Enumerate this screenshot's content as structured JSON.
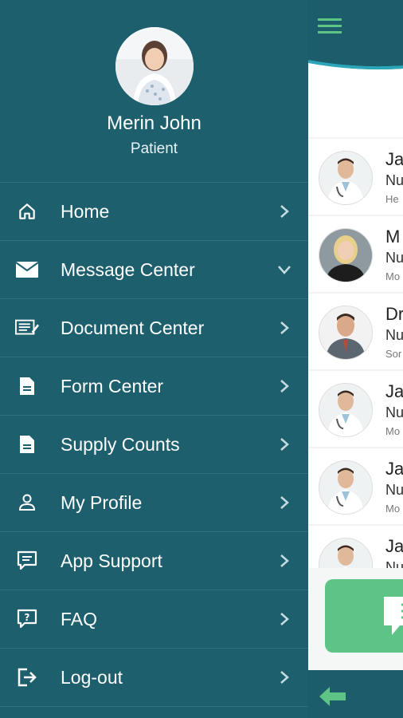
{
  "profile": {
    "name": "Merin John",
    "role": "Patient"
  },
  "menu": [
    {
      "label": "Home",
      "icon": "home-icon",
      "chevron": "right"
    },
    {
      "label": "Message Center",
      "icon": "envelope-icon",
      "chevron": "down"
    },
    {
      "label": "Document Center",
      "icon": "document-edit-icon",
      "chevron": "right"
    },
    {
      "label": "Form Center",
      "icon": "file-icon",
      "chevron": "right"
    },
    {
      "label": "Supply Counts",
      "icon": "file-icon",
      "chevron": "right"
    },
    {
      "label": "My Profile",
      "icon": "person-icon",
      "chevron": "right"
    },
    {
      "label": "App Support",
      "icon": "chat-icon",
      "chevron": "right"
    },
    {
      "label": "FAQ",
      "icon": "help-icon",
      "chevron": "right"
    },
    {
      "label": "Log-out",
      "icon": "logout-icon",
      "chevron": "right"
    }
  ],
  "contacts": [
    {
      "name": "Ja",
      "title": "Nu",
      "sub": "He",
      "avatar": "doctor"
    },
    {
      "name": "M",
      "title": "Nu",
      "sub": "Mo",
      "avatar": "woman"
    },
    {
      "name": "Dr",
      "title": "Nu",
      "sub": "Sor",
      "avatar": "man"
    },
    {
      "name": "Ja",
      "title": "Nu",
      "sub": "Mo",
      "avatar": "doctor"
    },
    {
      "name": "Ja",
      "title": "Nu",
      "sub": "Mo",
      "avatar": "doctor"
    },
    {
      "name": "Ja",
      "title": "Nu",
      "sub": "",
      "avatar": "doctor"
    }
  ],
  "colors": {
    "drawer": "#1e5f6d",
    "divider": "#2d7180",
    "accent": "#5ec486",
    "topbar": "#1d5d6b"
  }
}
